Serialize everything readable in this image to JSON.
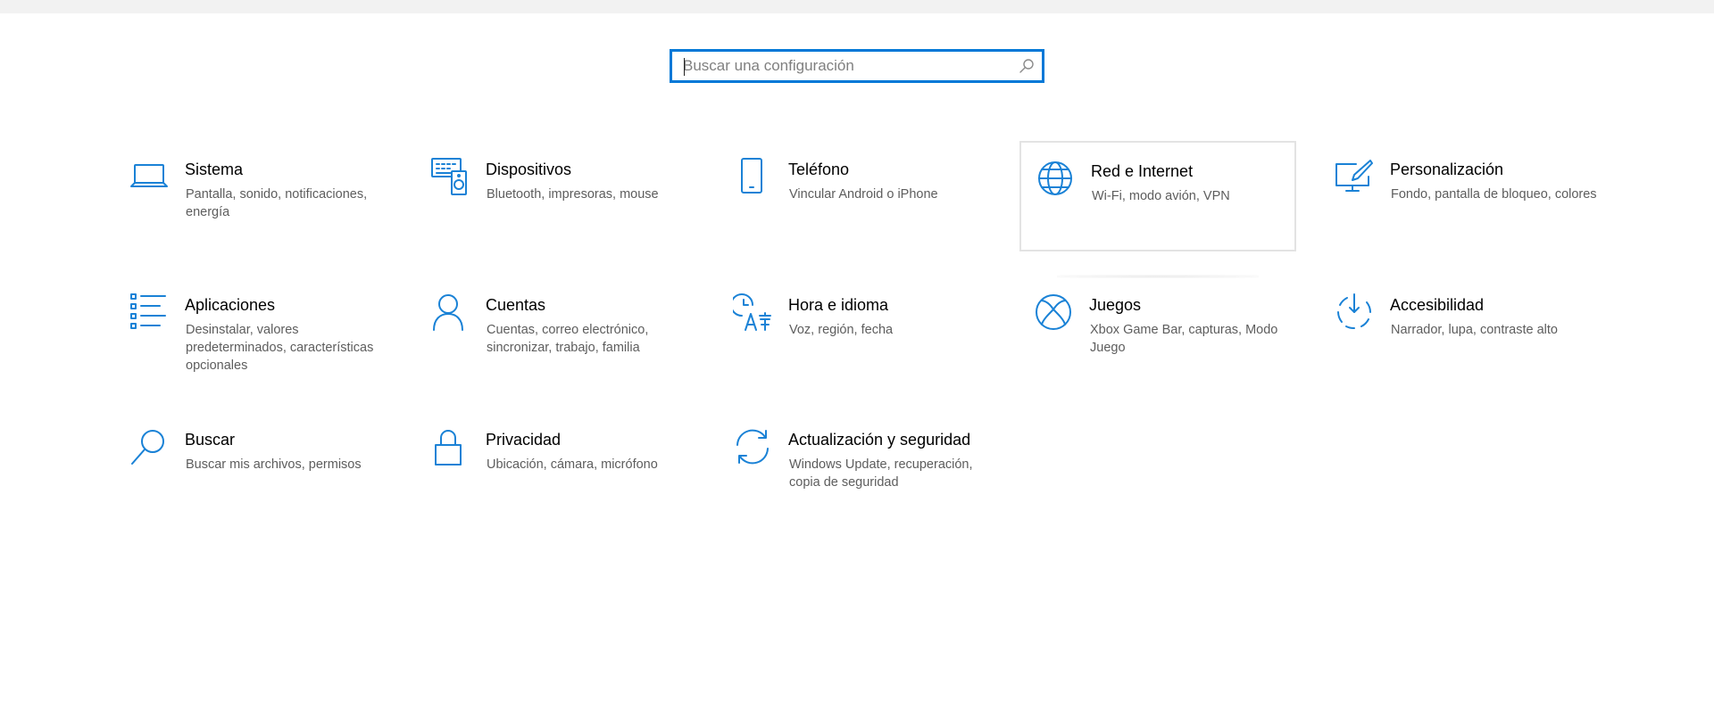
{
  "search": {
    "placeholder": "Buscar una configuración",
    "value": ""
  },
  "tiles": [
    {
      "title": "Sistema",
      "desc": "Pantalla, sonido, notificaciones, energía",
      "icon": "laptop-icon"
    },
    {
      "title": "Dispositivos",
      "desc": "Bluetooth, impresoras, mouse",
      "icon": "devices-icon"
    },
    {
      "title": "Teléfono",
      "desc": "Vincular Android o iPhone",
      "icon": "phone-icon"
    },
    {
      "title": "Red e Internet",
      "desc": "Wi-Fi, modo avión, VPN",
      "icon": "globe-icon"
    },
    {
      "title": "Personalización",
      "desc": "Fondo, pantalla de bloqueo, colores",
      "icon": "personalization-icon"
    },
    {
      "title": "Aplicaciones",
      "desc": "Desinstalar, valores predeterminados, características opcionales",
      "icon": "apps-list-icon"
    },
    {
      "title": "Cuentas",
      "desc": "Cuentas, correo electrónico, sincronizar, trabajo, familia",
      "icon": "person-icon"
    },
    {
      "title": "Hora e idioma",
      "desc": "Voz, región, fecha",
      "icon": "time-language-icon"
    },
    {
      "title": "Juegos",
      "desc": "Xbox Game Bar, capturas, Modo Juego",
      "icon": "xbox-icon"
    },
    {
      "title": "Accesibilidad",
      "desc": "Narrador, lupa, contraste alto",
      "icon": "accessibility-icon"
    },
    {
      "title": "Buscar",
      "desc": "Buscar mis archivos, permisos",
      "icon": "search-icon"
    },
    {
      "title": "Privacidad",
      "desc": "Ubicación, cámara, micrófono",
      "icon": "lock-icon"
    },
    {
      "title": "Actualización y seguridad",
      "desc": "Windows Update, recuperación, copia de seguridad",
      "icon": "update-icon"
    }
  ],
  "colors": {
    "accent": "#0078d7",
    "icon": "#1a82d6",
    "description": "#5d5d5d"
  }
}
